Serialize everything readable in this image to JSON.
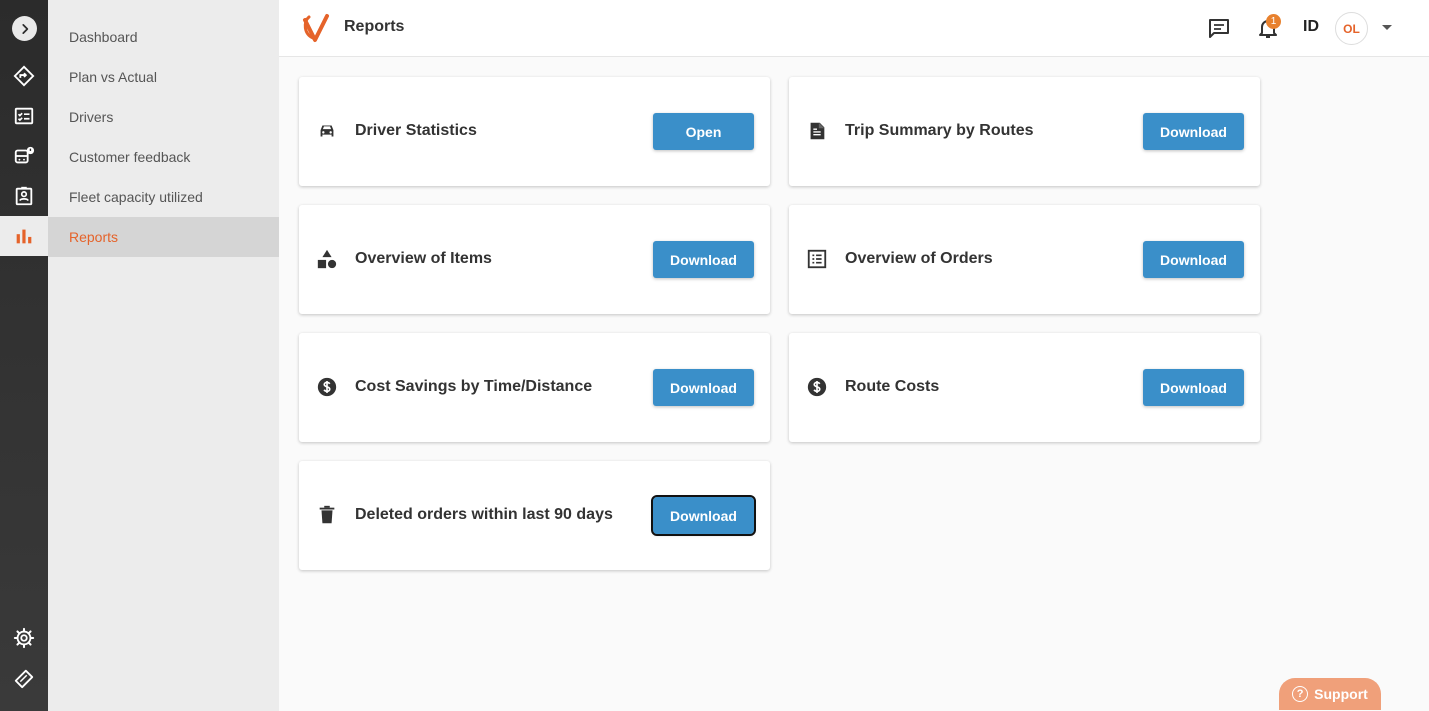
{
  "app": {
    "page_title": "Reports",
    "accent_color": "#e5632a",
    "button_color": "#3a8fc9"
  },
  "rail": {
    "items": [
      {
        "icon": "expand-chevron-icon"
      },
      {
        "icon": "route-diamond-icon"
      },
      {
        "icon": "checklist-icon"
      },
      {
        "icon": "bus-alert-icon"
      },
      {
        "icon": "contact-clipboard-icon"
      },
      {
        "icon": "bar-chart-icon",
        "active": true
      }
    ],
    "bottom": [
      {
        "icon": "gear-icon"
      },
      {
        "icon": "ticket-icon"
      }
    ]
  },
  "subnav": {
    "items": [
      {
        "label": "Dashboard"
      },
      {
        "label": "Plan vs Actual"
      },
      {
        "label": "Drivers"
      },
      {
        "label": "Customer feedback"
      },
      {
        "label": "Fleet capacity utilized"
      },
      {
        "label": "Reports",
        "active": true
      }
    ]
  },
  "header": {
    "notification_count": "1",
    "language": "ID",
    "avatar_initials": "OL"
  },
  "cards": [
    {
      "label": "Driver Statistics",
      "icon": "car-icon",
      "button": "Open"
    },
    {
      "label": "Trip Summary by Routes",
      "icon": "document-icon",
      "button": "Download"
    },
    {
      "label": "Overview of Items",
      "icon": "shapes-icon",
      "button": "Download"
    },
    {
      "label": "Overview of Orders",
      "icon": "list-icon",
      "button": "Download"
    },
    {
      "label": "Cost Savings by Time/Distance",
      "icon": "dollar-circle-icon",
      "button": "Download"
    },
    {
      "label": "Route Costs",
      "icon": "dollar-circle-icon",
      "button": "Download"
    },
    {
      "label": "Deleted orders within last 90 days",
      "icon": "trash-icon",
      "button": "Download",
      "focused": true
    }
  ],
  "support": {
    "label": "Support",
    "icon": "help-circle-icon"
  }
}
